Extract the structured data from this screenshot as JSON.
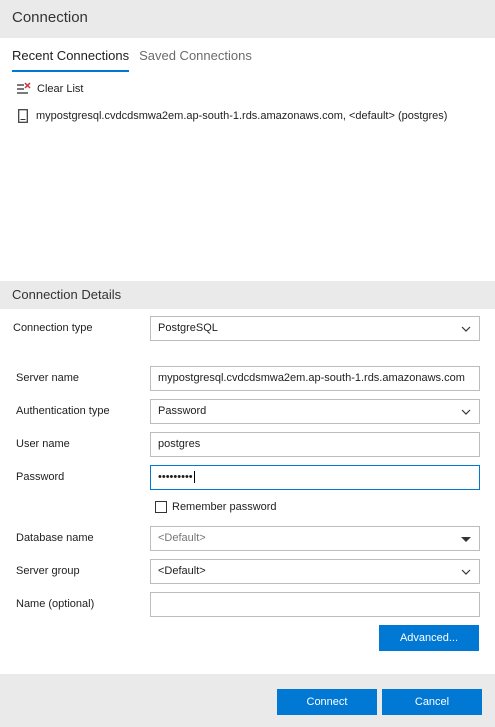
{
  "dialog": {
    "title": "Connection"
  },
  "tabs": [
    {
      "label": "Recent Connections",
      "active": true
    },
    {
      "label": "Saved Connections",
      "active": false
    }
  ],
  "recent": {
    "clear_list_label": "Clear List",
    "clear_list_icon": "clear-list-icon",
    "items": [
      {
        "label": "mypostgresql.cvdcdsmwa2em.ap-south-1.rds.amazonaws.com, <default> (postgres)",
        "icon": "server-icon"
      }
    ]
  },
  "details": {
    "title": "Connection Details",
    "connection_type": {
      "label": "Connection type",
      "value": "PostgreSQL"
    },
    "server_name": {
      "label": "Server name",
      "value": "mypostgresql.cvdcdsmwa2em.ap-south-1.rds.amazonaws.com"
    },
    "auth_type": {
      "label": "Authentication type",
      "value": "Password"
    },
    "user_name": {
      "label": "User name",
      "value": "postgres"
    },
    "password": {
      "label": "Password",
      "value": "•••••••••"
    },
    "remember_password": {
      "label": "Remember password",
      "checked": false
    },
    "database_name": {
      "label": "Database name",
      "placeholder": "<Default>"
    },
    "server_group": {
      "label": "Server group",
      "placeholder": "<Default>"
    },
    "name_optional": {
      "label": "Name (optional)",
      "value": ""
    },
    "advanced_label": "Advanced..."
  },
  "footer": {
    "connect_label": "Connect",
    "cancel_label": "Cancel"
  },
  "colors": {
    "accent": "#0078d4",
    "header_bg": "#eaeaea",
    "border": "#bdbdbd"
  }
}
